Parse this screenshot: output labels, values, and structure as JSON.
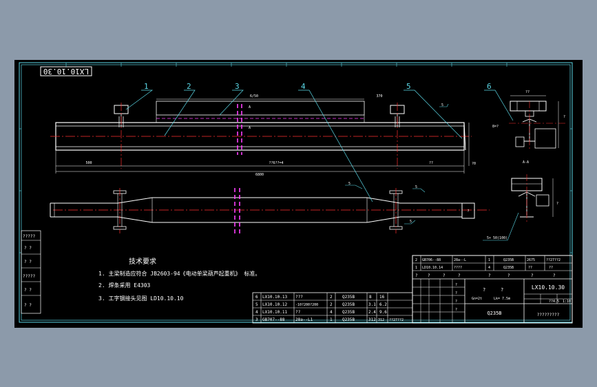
{
  "drawing_no": "LX10.10.30",
  "drawing_no_rotated": "LX10.10.30",
  "balloons": [
    "1",
    "2",
    "3",
    "4",
    "5",
    "6"
  ],
  "dims": {
    "top_a": "6/50",
    "top_b": "370",
    "bottom_left": "500",
    "bottom_mid": "??6??=4",
    "bottom_right": "??",
    "overall": "6800",
    "section_width": "??",
    "section_h": "?",
    "left_gap": "8=?",
    "right_box": "?0",
    "callout_50": "5×  50(100)",
    "sect_mark": "A-A"
  },
  "weld_labels": {
    "w1": "5",
    "w2": "5",
    "w3": "5",
    "w4": "5"
  },
  "left_labels": [
    "?????",
    "? ?",
    "? ?",
    "?????",
    "? ?",
    "? ?"
  ],
  "tech_title": "技术要求",
  "tech_notes": [
    "1.  主梁制造应符合 JB2603-94《电动单梁葫芦起重机》 标准。",
    "2.  焊条采用 E4303",
    "3.  工字钢接头见图 LD10.10.10"
  ],
  "bom_rows": [
    {
      "no": "6",
      "code": "LX10.10.13",
      "name": "???",
      "qty": "2",
      "mat": "Q235B",
      "w1": "8",
      "w2": "16"
    },
    {
      "no": "5",
      "code": "LX10.10.12",
      "name": "-10?200?200",
      "qty": "2",
      "mat": "Q235B",
      "w1": "3.1",
      "w2": "6.2"
    },
    {
      "no": "4",
      "code": "LX10.10.11",
      "name": "??",
      "qty": "4",
      "mat": "Q235B",
      "w1": "2.4",
      "w2": "9.6"
    },
    {
      "no": "3",
      "code": "GB707--88",
      "name": "28a--L1",
      "qty": "1",
      "mat": "Q235B",
      "w1": "312",
      "w2": "312"
    }
  ],
  "bom_extra": "??27??2",
  "title_rows": [
    {
      "no": "2",
      "code": "GB706--88",
      "name": "28a--L",
      "qty": "1",
      "mat": "Q235B",
      "w1": "2675",
      "w2": "??27??2"
    },
    {
      "no": "1",
      "code": "LD10.10.14",
      "name": "????",
      "qty": "4",
      "mat": "Q235B",
      "w1": "??",
      "w2": "??"
    }
  ],
  "title_hdr": [
    "?",
    "?",
    "?",
    "?",
    "?",
    "?",
    "?",
    "?"
  ],
  "title_block": {
    "design_a": "?",
    "design_b": "?",
    "spec": "Gn=2t",
    "span": "Lk= 7.5m",
    "material": "Q235B",
    "drawing": "LX10.10.30",
    "weight": "??4.5",
    "scale": "1:10",
    "company": "?????????",
    "small": [
      "?",
      "?",
      "?",
      "?"
    ]
  }
}
